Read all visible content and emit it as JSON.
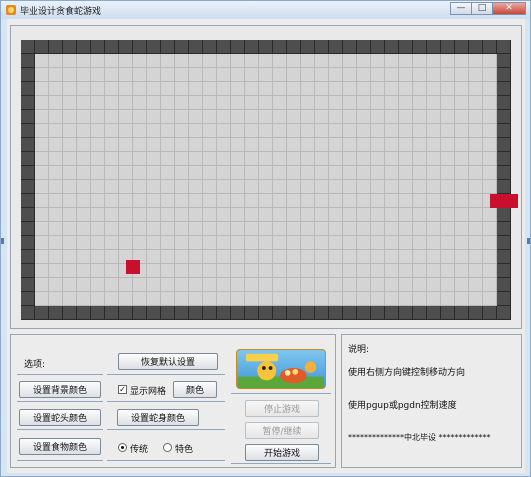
{
  "window": {
    "title": "毕业设计贪食蛇游戏",
    "controls": {
      "minimize": "—",
      "maximize": "□",
      "close": "✕"
    }
  },
  "controls_panel": {
    "options_label": "选项:",
    "restore_defaults_button": "恢复默认设置",
    "bg_color_button": "设置背景颜色",
    "show_grid_label": "显示网格",
    "show_grid_checked": true,
    "color_button": "颜色",
    "head_color_button": "设置蛇头颜色",
    "body_color_button": "设置蛇身颜色",
    "food_color_button": "设置食物颜色",
    "mode_options": [
      {
        "label": "传统",
        "selected": true
      },
      {
        "label": "特色",
        "selected": false
      }
    ]
  },
  "game_buttons": {
    "stop": "停止游戏",
    "pause": "暂停/继续",
    "start": "开始游戏"
  },
  "instructions": {
    "title": "说明:",
    "line1": "使用右侧方向键控制移动方向",
    "line2": "使用pgup或pgdn控制速度",
    "line3": "**************中北毕设 *************"
  },
  "colors": {
    "board": "#d4d4d4",
    "grid": "#b9b9b9",
    "wall": "#4e4e4e",
    "snake_and_food": "#c8102e"
  }
}
